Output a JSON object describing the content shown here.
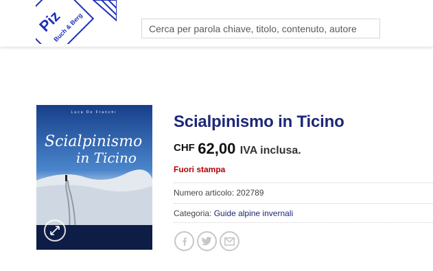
{
  "header": {
    "logo_text": "Piz",
    "logo_subtext": "Buch & Berg",
    "search_placeholder": "Cerca per parola chiave, titolo, contenuto, autore"
  },
  "product": {
    "title": "Scialpinismo in Ticino",
    "currency": "CHF",
    "price": "62,00",
    "vat_label": "IVA inclusa.",
    "stock_status": "Fuori stampa",
    "sku_label": "Numero articolo:",
    "sku": "202789",
    "category_label": "Categoria:",
    "category": "Guide alpine invernali",
    "cover": {
      "author": "Luca De Franchi",
      "title_line1": "Scialpinismo",
      "title_line2": "in Ticino"
    }
  },
  "share": {
    "icons": [
      "facebook-icon",
      "twitter-icon",
      "email-icon"
    ]
  },
  "colors": {
    "title": "#1d2777",
    "stock": "#b20000",
    "logo_blue": "#1f2fb8"
  }
}
